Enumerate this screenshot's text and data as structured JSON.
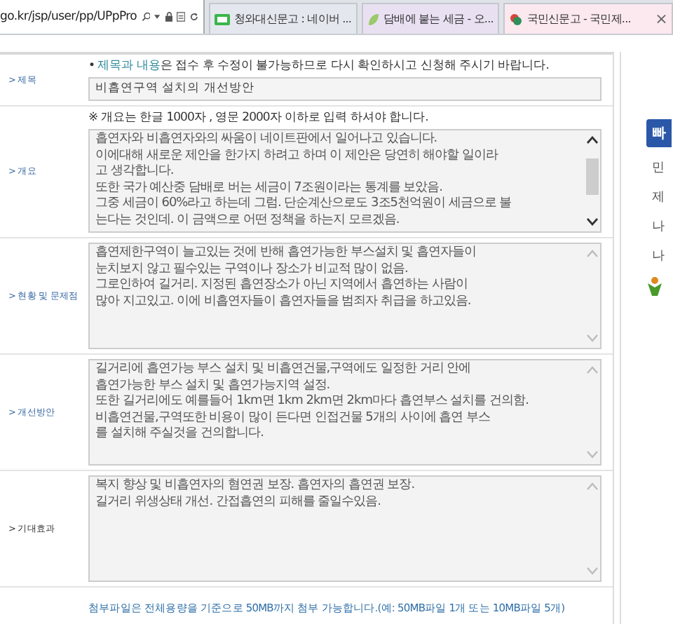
{
  "browser": {
    "address": "go.kr/jsp/user/pp/UPpPro",
    "tabs": [
      {
        "title": "청와대신문고 : 네이버 ...",
        "selected": false,
        "kind": "green"
      },
      {
        "title": "담배에 붙는 세금 - 오...",
        "selected": false,
        "kind": "leaf"
      },
      {
        "title": "국민신문고 - 국민제...",
        "selected": true,
        "kind": "flower",
        "close": "×"
      }
    ]
  },
  "form": {
    "title_row": {
      "label": "> 제목",
      "notice": [
        {
          "text": "• ",
          "kind": "plain"
        },
        {
          "text": "제목과 내용",
          "kind": "highlight"
        },
        {
          "text": "은 접수 후 수정이 불가능하므로 다시 확인하시고 신청해 주시기 바랍니다.",
          "kind": "plain"
        }
      ],
      "value": "비흡연구역 설치의 개선방안"
    },
    "sections": [
      {
        "label": "> 개요",
        "note": "※ 개요는 한글 1000자 , 영문 2000자 이하로 입력 하셔야 합니다.",
        "scrollbar": true,
        "lines": [
          "흡연자와 비흡연자와의 싸움이 네이트판에서 일어나고 있습니다.",
          "이에대해 새로운 제안을 한가지 하려고 하며 이 제안은 당연히 해야할 일이라",
          "고 생각합니다.",
          "또한 국가 예산중 담배로 버는 세금이 7조원이라는 통계를 보았음.",
          "그중 세금이 60%라고 하는데 그럼. 단순계산으로도 3조5천억원이 세금으로 불",
          "는다는 것인데. 이 금액으로 어떤 정책을 하는지 모르겠음."
        ]
      },
      {
        "label": "> 현황 및 문제점",
        "scrollbar": false,
        "lines": [
          "흡연제한구역이 늘고있는 것에 반해 흡연가능한 부스설치 및 흡연자들이",
          "눈치보지 않고 필수있는 구역이나 장소가 비교적 많이 없음.",
          "그로인하여 길거리. 지정된 흡연장소가 아닌 지역에서 흡연하는 사람이",
          "많아 지고있고. 이에 비흡연자들이 흡연자들을 범죄자 취급을 하고있음."
        ]
      },
      {
        "label": "> 개선방안",
        "scrollbar": false,
        "lines": [
          "길거리에 흡연가능 부스 설치 및 비흡연건물,구역에도 일정한 거리 안에",
          "흡연가능한 부스 설치 및 흡연가능지역 설정.",
          "또한 길거리에도 예를들어 1km면 1km 2km면 2km마다 흡연부스 설치를 건의함.",
          "비흡연건물,구역또한 비용이 많이 든다면 인접건물 5개의 사이에 흡연 부스",
          "를 설치해 주실것을 건의합니다."
        ]
      },
      {
        "label": "> 기대효과",
        "scrollbar": false,
        "lines": [
          "복지 향상 및 비흡연자의 혐연권 보장. 흡연자의 흡연권 보장.",
          "길거리 위생상태 개선. 간접흡연의 피해를 줄일수있음."
        ]
      }
    ],
    "attachment_note": "첨부파일은 전체용량을 기준으로 50MB까지 첨부 가능합니다.(예: 50MB파일 1개 또는 10MB파일 5개)"
  },
  "side": {
    "tab": "빠",
    "items": [
      "민",
      "제",
      "나",
      "나"
    ]
  }
}
